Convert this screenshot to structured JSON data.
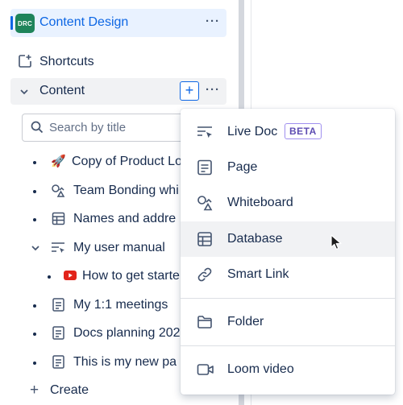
{
  "space": {
    "avatar_text": "DRC",
    "name": "Content Design",
    "more": "···"
  },
  "shortcuts": {
    "label": "Shortcuts"
  },
  "content": {
    "label": "Content",
    "add": "+",
    "more": "···"
  },
  "search": {
    "placeholder": "Search by title"
  },
  "tree": [
    {
      "label": "Copy of Product Lo",
      "icon": "rocket-emoji",
      "emoji": "🚀"
    },
    {
      "label": "Team Bonding whi",
      "icon": "whiteboard-icon"
    },
    {
      "label": "Names and addre",
      "icon": "database-icon"
    },
    {
      "label": "My user manual",
      "icon": "live-doc-icon",
      "expanded": true
    },
    {
      "label": "How to get starte",
      "icon": "youtube-icon"
    },
    {
      "label": "My 1:1 meetings",
      "icon": "page-icon"
    },
    {
      "label": "Docs planning 202",
      "icon": "page-icon"
    },
    {
      "label": "This is my new pa",
      "icon": "page-icon"
    }
  ],
  "create": {
    "label": "Create",
    "plus": "+"
  },
  "menu": {
    "items": [
      {
        "label": "Live Doc",
        "badge": "BETA",
        "icon": "live-doc-icon"
      },
      {
        "label": "Page",
        "icon": "page-icon"
      },
      {
        "label": "Whiteboard",
        "icon": "whiteboard-icon"
      },
      {
        "label": "Database",
        "icon": "database-icon",
        "hovered": true
      },
      {
        "label": "Smart Link",
        "icon": "link-icon"
      },
      {
        "label": "Folder",
        "icon": "folder-icon"
      },
      {
        "label": "Loom video",
        "icon": "video-icon"
      }
    ]
  },
  "colors": {
    "accent": "#0c66e4",
    "avatar": "#1f845a",
    "hover": "#f1f2f4",
    "beta": "#5e4db2"
  }
}
